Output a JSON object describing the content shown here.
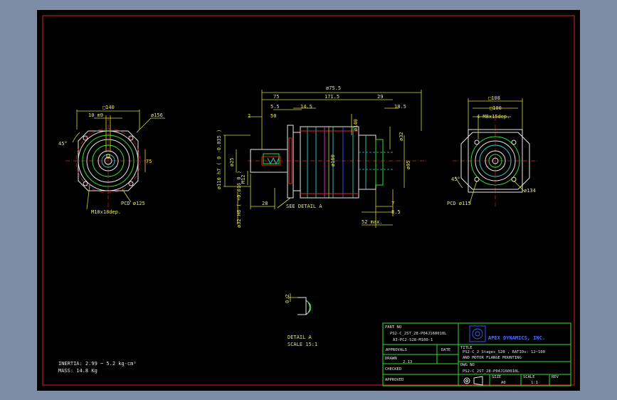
{
  "drawing": {
    "left_view": {
      "square_dim": "□140",
      "bolt_label": "10 m9",
      "dia_156": "ø156",
      "angle": "45°",
      "dim_75": "75",
      "pcd_label": "PCD ø125",
      "hole_label": "M10x18dep."
    },
    "center_view": {
      "dims_top": {
        "overall": "ø75.5",
        "d75": "75",
        "d171": "171.5",
        "d29": "29",
        "d55": "5.5",
        "d50": "50",
        "d145": "14.5",
        "d185": "18.5",
        "d2": "2"
      },
      "dims_side": {
        "d110": "ø110 h7 ( 0 -0.035 )",
        "d25": "ø25",
        "m12": "M12",
        "d32": "ø32 H6 ( +0.016 0 )"
      },
      "dims_body": {
        "d140": "ø140",
        "d160": "ø160",
        "d32b": "ø32",
        "d95": "ø95"
      },
      "dims_bottom": {
        "d28": "28",
        "see_detail": "SEE DETAIL A",
        "d7": "7",
        "d85": "8.5",
        "d52": "52 max."
      }
    },
    "right_view": {
      "sq108": "□108",
      "sq100": "□100",
      "hole_label": "4-M8x15dep.",
      "angle": "45°",
      "d134": "ø134",
      "pcd_label": "PCD ø115"
    },
    "detail": {
      "dim": "0.2",
      "title": "DETAIL A",
      "scale": "SCALE 15:1"
    },
    "notes": {
      "inertia": "INERTIA: 2.99 ~ 5.2 kg-cm²",
      "mass": "MASS: 14.8 Kg"
    }
  },
  "title_block": {
    "part_no_label": "PART NO",
    "part_no_1": "PS2-C_2ST_28-P04J160010L",
    "part_no_2": "A3-PC2-S28-M100-1",
    "company": "APEX DYNAMICS, INC.",
    "approvals_label": "APPROVALS",
    "date_label": "DATE",
    "title_label": "TITLE",
    "title_line1": "PS2-C_2 Stages_S28 , RATIOs: 12~100",
    "title_line2": "AND MOTOR FLANGE MOUNTING",
    "drawn_label": "DRAWN",
    "drawn_value": "2.13",
    "checked_label": "CHECKED",
    "dwg_no_label": "DWG NO",
    "dwg_no_value": "PS2-C_2ST_28-P04J160010L",
    "approved_label": "APPROVED",
    "size_label": "SIZE",
    "size_value": "A0",
    "scale_label": "SCALE",
    "scale_value": "1:1",
    "rev_label": "REV"
  }
}
